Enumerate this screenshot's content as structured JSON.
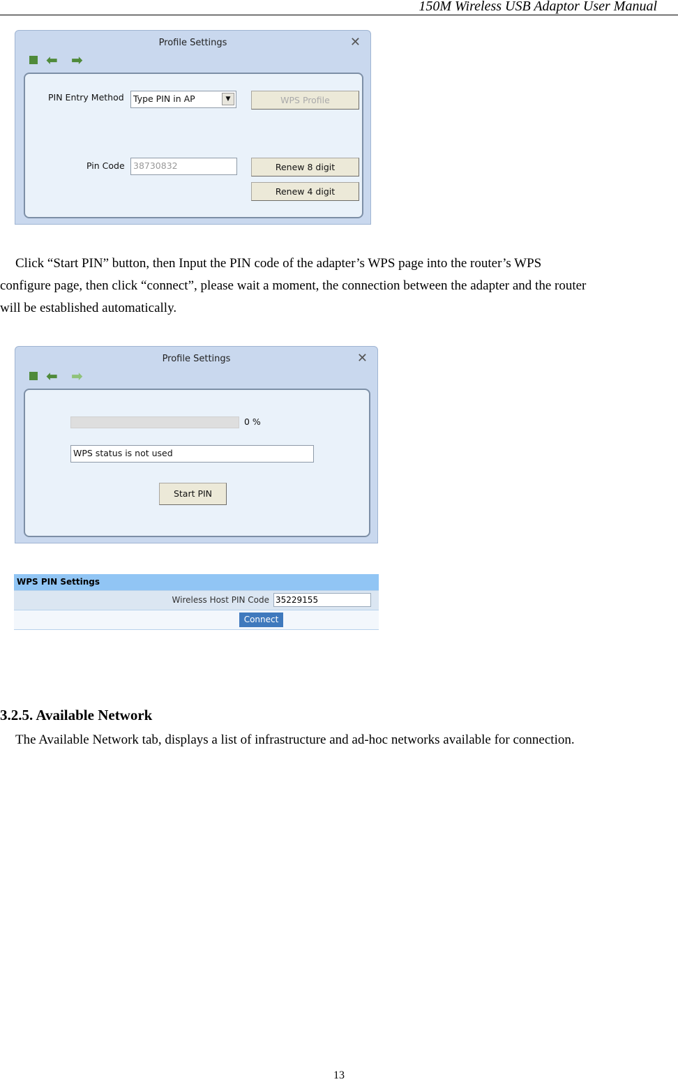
{
  "header": {
    "title": "150M Wireless USB Adaptor User Manual"
  },
  "window1": {
    "title": "Profile Settings",
    "pin_entry_label": "PIN Entry Method",
    "pin_entry_value": "Type PIN in AP",
    "wps_profile_button": "WPS Profile",
    "pin_code_label": "Pin Code",
    "pin_code_value": "38730832",
    "renew8_button": "Renew 8 digit",
    "renew4_button": "Renew 4 digit"
  },
  "paragraph1": {
    "line1": "Click “Start PIN” button, then Input the PIN code of the adapter’s WPS page into the router’s WPS",
    "line2": "configure page, then click “connect”, please wait a moment, the connection between the adapter and the router",
    "line3": "will be established automatically."
  },
  "window2": {
    "title": "Profile Settings",
    "progress_percent": 0,
    "progress_label": "0 %",
    "status_text": "WPS status is not used",
    "start_pin_button": "Start PIN"
  },
  "router": {
    "heading": "WPS PIN Settings",
    "pin_label": "Wireless Host PIN Code",
    "pin_value": "35229155",
    "connect_button": "Connect"
  },
  "section": {
    "heading": "3.2.5. Available Network",
    "text": "The Available Network tab, displays a list of infrastructure and ad-hoc networks available for connection."
  },
  "page_number": "13"
}
